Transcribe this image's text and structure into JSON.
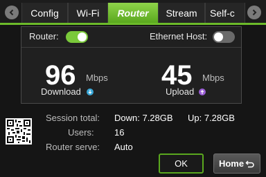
{
  "tabs": [
    {
      "label": "Config",
      "active": false
    },
    {
      "label": "Wi-Fi",
      "active": false
    },
    {
      "label": "Router",
      "active": true
    },
    {
      "label": "Stream",
      "active": false
    },
    {
      "label": "Self-c",
      "active": false
    }
  ],
  "router": {
    "label": "Router:",
    "enabled": true
  },
  "ethernet_host": {
    "label": "Ethernet Host:",
    "enabled": false
  },
  "download": {
    "value": "96",
    "unit": "Mbps",
    "label": "Download"
  },
  "upload": {
    "value": "45",
    "unit": "Mbps",
    "label": "Upload"
  },
  "session": {
    "label": "Session total:",
    "down": "Down: 7.28GB",
    "up": "Up: 7.28GB"
  },
  "users": {
    "label": "Users:",
    "value": "16"
  },
  "router_server": {
    "label": "Router serve:",
    "value": "Auto"
  },
  "buttons": {
    "ok": "OK",
    "home": "Home"
  },
  "colors": {
    "accent": "#6cbb2a",
    "download_icon": "#3aa8d8",
    "upload_icon": "#9b5fd6"
  }
}
